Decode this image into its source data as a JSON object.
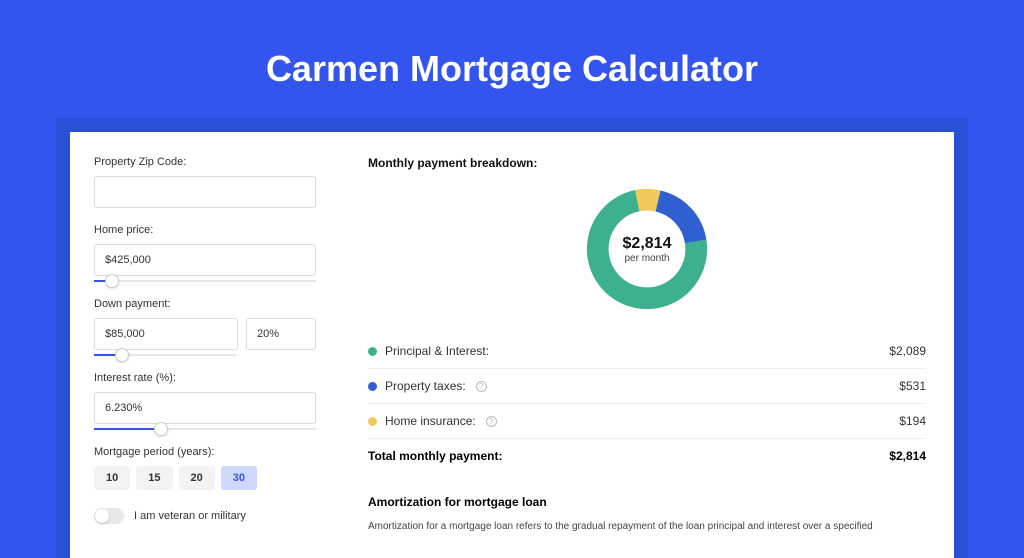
{
  "title": "Carmen Mortgage Calculator",
  "form": {
    "zip_label": "Property Zip Code:",
    "zip_value": "",
    "price_label": "Home price:",
    "price_value": "$425,000",
    "price_slider_pct": 8,
    "down_label": "Down payment:",
    "down_value": "$85,000",
    "down_pct_value": "20%",
    "down_slider_pct": 20,
    "rate_label": "Interest rate (%):",
    "rate_value": "6.230%",
    "rate_slider_pct": 30,
    "period_label": "Mortgage period (years):",
    "periods": [
      "10",
      "15",
      "20",
      "30"
    ],
    "period_active_index": 3,
    "veteran_label": "I am veteran or military"
  },
  "breakdown": {
    "title": "Monthly payment breakdown:",
    "center_amount": "$2,814",
    "center_sub": "per month",
    "items": [
      {
        "label": "Principal & Interest:",
        "value": "$2,089",
        "color": "#3cb08f",
        "has_help": false,
        "deg": 267
      },
      {
        "label": "Property taxes:",
        "value": "$531",
        "color": "#2f5fd0",
        "has_help": true,
        "deg": 68
      },
      {
        "label": "Home insurance:",
        "value": "$194",
        "color": "#f1c95b",
        "has_help": true,
        "deg": 25
      }
    ],
    "total_label": "Total monthly payment:",
    "total_value": "$2,814"
  },
  "amortization": {
    "title": "Amortization for mortgage loan",
    "text": "Amortization for a mortgage loan refers to the gradual repayment of the loan principal and interest over a specified"
  },
  "chart_data": {
    "type": "pie",
    "title": "Monthly payment breakdown",
    "series": [
      {
        "name": "Principal & Interest",
        "value": 2089,
        "color": "#3cb08f"
      },
      {
        "name": "Property taxes",
        "value": 531,
        "color": "#2f5fd0"
      },
      {
        "name": "Home insurance",
        "value": 194,
        "color": "#f1c95b"
      }
    ],
    "total": 2814,
    "center_label": "$2,814 per month"
  }
}
